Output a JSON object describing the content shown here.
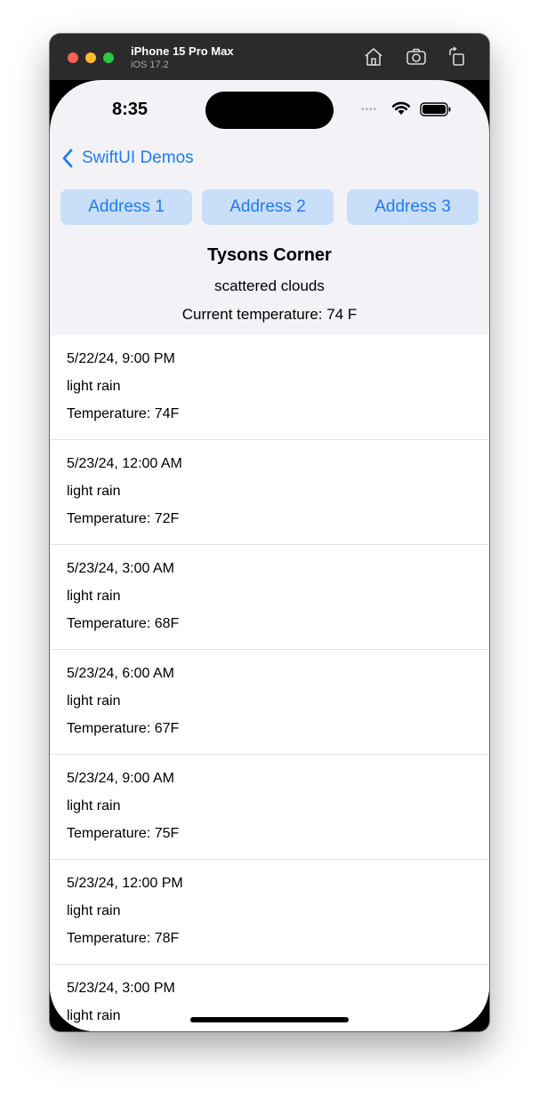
{
  "simulator": {
    "device_name": "iPhone 15 Pro Max",
    "os_version": "iOS 17.2",
    "toolbar_icons": [
      "home-icon",
      "screenshot-icon",
      "rotate-icon"
    ]
  },
  "status_bar": {
    "time": "8:35",
    "signal_dots": "••••",
    "icons": [
      "wifi-icon",
      "battery-icon"
    ]
  },
  "nav": {
    "back_label": "SwiftUI Demos"
  },
  "address_buttons": [
    {
      "label": "Address 1"
    },
    {
      "label": "Address 2"
    },
    {
      "label": "Address 3"
    }
  ],
  "location": {
    "name": "Tysons Corner",
    "description": "scattered clouds",
    "current_temperature": "Current temperature: 74 F"
  },
  "forecast": [
    {
      "datetime": "5/22/24, 9:00 PM",
      "description": "light rain",
      "temperature": "Temperature: 74F"
    },
    {
      "datetime": "5/23/24, 12:00 AM",
      "description": "light rain",
      "temperature": "Temperature: 72F"
    },
    {
      "datetime": "5/23/24, 3:00 AM",
      "description": "light rain",
      "temperature": "Temperature: 68F"
    },
    {
      "datetime": "5/23/24, 6:00 AM",
      "description": "light rain",
      "temperature": "Temperature: 67F"
    },
    {
      "datetime": "5/23/24, 9:00 AM",
      "description": "light rain",
      "temperature": "Temperature: 75F"
    },
    {
      "datetime": "5/23/24, 12:00 PM",
      "description": "light rain",
      "temperature": "Temperature: 78F"
    },
    {
      "datetime": "5/23/24, 3:00 PM",
      "description": "light rain",
      "temperature": ""
    }
  ],
  "colors": {
    "accent": "#1f7bf5",
    "button_bg": "#c9def8",
    "screen_bg": "#f2f2f7",
    "list_bg": "#ffffff",
    "titlebar_bg": "#2b2b2b"
  }
}
